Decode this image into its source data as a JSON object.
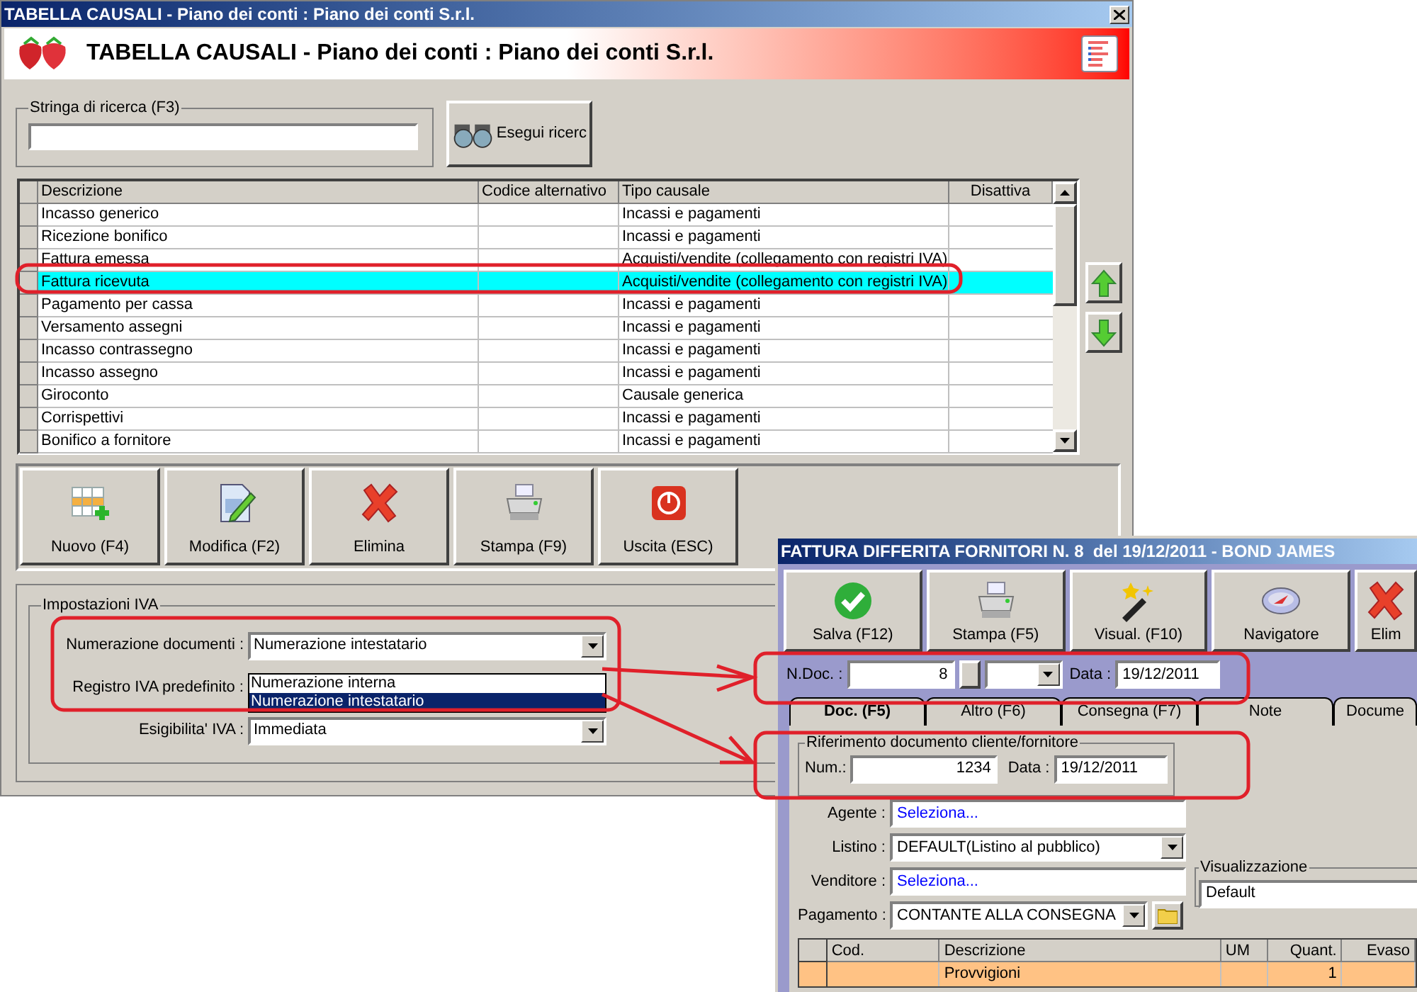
{
  "main_window": {
    "title": "TABELLA CAUSALI - Piano dei conti : Piano dei conti S.r.l.",
    "header_title": "TABELLA CAUSALI - Piano dei conti : Piano dei conti S.r.l.",
    "search": {
      "label": "Stringa di ricerca (F3)",
      "button": "Esegui ricerc"
    },
    "table": {
      "columns": [
        "Descrizione",
        "Codice alternativo",
        "Tipo causale",
        "Disattiva"
      ],
      "rows": [
        {
          "description": "Incasso generico",
          "type": "Incassi e pagamenti",
          "selected": false
        },
        {
          "description": "Ricezione bonifico",
          "type": "Incassi e pagamenti",
          "selected": false
        },
        {
          "description": "Fattura emessa",
          "type": "Acquisti/vendite (collegamento con registri IVA)",
          "selected": false
        },
        {
          "description": "Fattura ricevuta",
          "type": "Acquisti/vendite (collegamento con registri IVA)",
          "selected": true
        },
        {
          "description": "Pagamento per cassa",
          "type": "Incassi e pagamenti",
          "selected": false
        },
        {
          "description": "Versamento assegni",
          "type": "Incassi e pagamenti",
          "selected": false
        },
        {
          "description": "Incasso contrassegno",
          "type": "Incassi e pagamenti",
          "selected": false
        },
        {
          "description": "Incasso assegno",
          "type": "Incassi e pagamenti",
          "selected": false
        },
        {
          "description": "Giroconto",
          "type": "Causale generica",
          "selected": false
        },
        {
          "description": "Corrispettivi",
          "type": "Incassi e pagamenti",
          "selected": false
        },
        {
          "description": "Bonifico a fornitore",
          "type": "Incassi e pagamenti",
          "selected": false
        }
      ]
    },
    "toolbar": [
      {
        "label": "Nuovo (F4)",
        "kind": "new"
      },
      {
        "label": "Modifica (F2)",
        "kind": "edit"
      },
      {
        "label": "Elimina",
        "kind": "delete"
      },
      {
        "label": "Stampa (F9)",
        "kind": "print"
      },
      {
        "label": "Uscita (ESC)",
        "kind": "exit"
      }
    ],
    "iva_settings": {
      "title": "Impostazioni IVA",
      "fields": [
        {
          "label": "Numerazione documenti :",
          "value": "Numerazione intestatario"
        },
        {
          "label": "Registro IVA predefinito :"
        },
        {
          "label": "Esigibilita' IVA :",
          "value": "Immediata"
        }
      ],
      "dropdown_options": [
        {
          "label": "Numerazione interna",
          "selected": false
        },
        {
          "label": "Numerazione intestatario",
          "selected": true
        }
      ]
    }
  },
  "invoice_window": {
    "title": "FATTURA DIFFERITA FORNITORI N. 8  del 19/12/2011 - BOND JAMES",
    "toolbar": [
      {
        "label": "Salva (F12)",
        "kind": "save"
      },
      {
        "label": "Stampa (F5)",
        "kind": "print"
      },
      {
        "label": "Visual. (F10)",
        "kind": "wand"
      },
      {
        "label": "Navigatore",
        "kind": "compass"
      },
      {
        "label": "Elim",
        "kind": "delete"
      }
    ],
    "doc_number": {
      "label": "N.Doc. :",
      "value": "8",
      "date_label": "Data :",
      "date_value": "19/12/2011"
    },
    "tabs": [
      {
        "label": "Doc. (F5)",
        "selected": true
      },
      {
        "label": "Altro (F6)",
        "selected": false
      },
      {
        "label": "Consegna (F7)",
        "selected": false
      },
      {
        "label": "Note",
        "selected": false
      },
      {
        "label": "Docume",
        "selected": false
      }
    ],
    "reference": {
      "title": "Riferimento documento cliente/fornitore",
      "num_label": "Num.:",
      "num_value": "1234",
      "date_label": "Data :",
      "date_value": "19/12/2011"
    },
    "fields": [
      {
        "label": "Agente :",
        "value": "Seleziona...",
        "kind": "link"
      },
      {
        "label": "Listino :",
        "value": "DEFAULT(Listino al pubblico)",
        "kind": "combo"
      },
      {
        "label": "Venditore :",
        "value": "Seleziona...",
        "kind": "link"
      },
      {
        "label": "Pagamento :",
        "value": "CONTANTE ALLA CONSEGNA",
        "kind": "combo_folder"
      }
    ],
    "view_group": {
      "title": "Visualizzazione",
      "value": "Default"
    },
    "grid": {
      "columns": [
        "Cod.",
        "Descrizione",
        "UM",
        "Quant.",
        "Evaso"
      ],
      "rows": [
        {
          "cells": [
            "",
            "Provvigioni",
            "",
            "1",
            ""
          ]
        }
      ]
    }
  }
}
